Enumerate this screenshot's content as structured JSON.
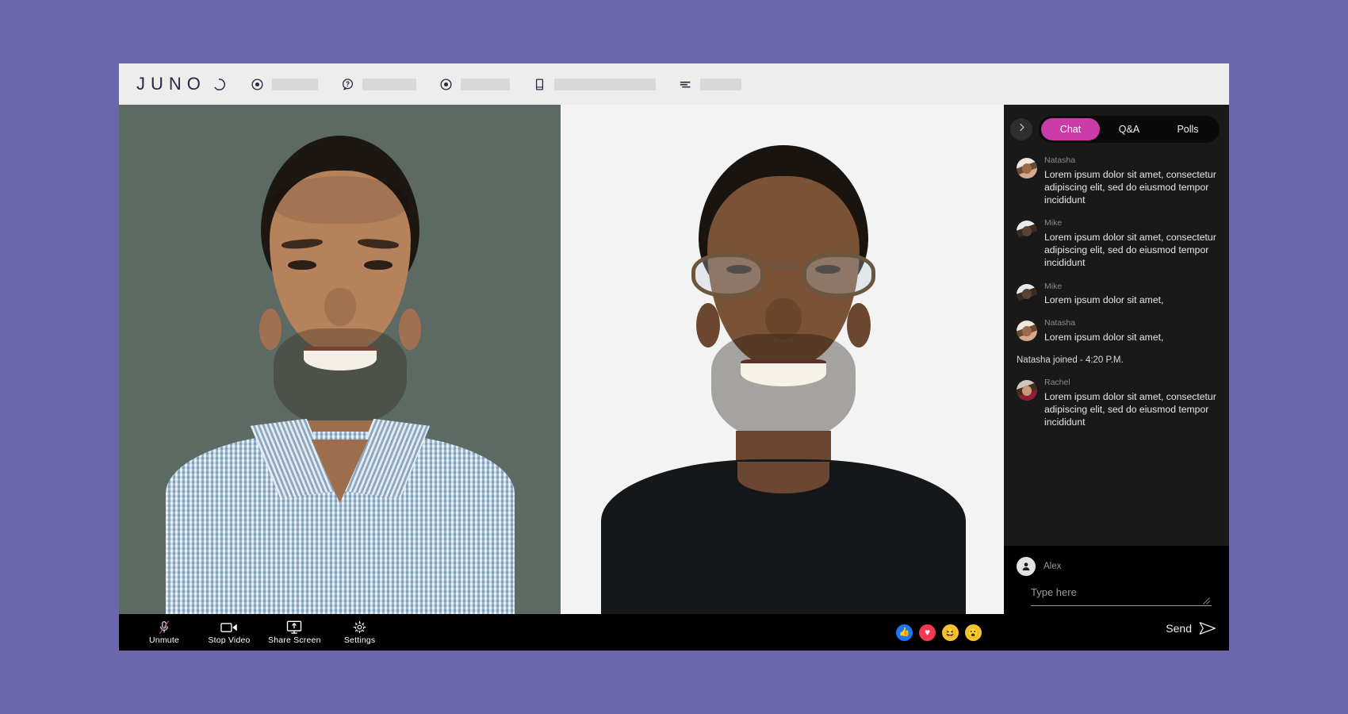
{
  "theme": {
    "page_background": "#6C67AC",
    "header_background": "#EDEDED",
    "chat_background": "#191919",
    "accent_pink": "#CB3BA8",
    "toolbar_background": "#000000"
  },
  "header": {
    "logo_text": "JUNO",
    "nav_items": [
      {
        "icon": "record-dot-icon",
        "placeholder_width": 58
      },
      {
        "icon": "question-bubble-icon",
        "placeholder_width": 68
      },
      {
        "icon": "record-dot-icon",
        "placeholder_width": 62
      },
      {
        "icon": "book-icon",
        "placeholder_width": 128
      },
      {
        "icon": "filter-lines-icon",
        "placeholder_width": 52
      }
    ]
  },
  "stage": {
    "participants": [
      {
        "name": "participant-one",
        "background": "#5C6A63"
      },
      {
        "name": "participant-two",
        "background": "#F2F3F2"
      }
    ]
  },
  "toolbar": {
    "controls": [
      {
        "id": "unmute",
        "label": "Unmute",
        "icon": "microphone-muted-icon"
      },
      {
        "id": "stop-video",
        "label": "Stop Video",
        "icon": "video-camera-icon"
      },
      {
        "id": "share-screen",
        "label": "Share Screen",
        "icon": "share-screen-icon"
      },
      {
        "id": "settings",
        "label": "Settings",
        "icon": "gear-icon"
      }
    ],
    "reactions": [
      {
        "id": "thumbs-up",
        "glyph": "👍",
        "color": "#1877F2"
      },
      {
        "id": "heart",
        "glyph": "♥",
        "color": "#F3384F"
      },
      {
        "id": "laughing",
        "glyph": "😆",
        "color": "#F7C430"
      },
      {
        "id": "surprised",
        "glyph": "😮",
        "color": "#F7C430"
      }
    ]
  },
  "chat": {
    "collapse_icon": "chevron-right-icon",
    "tabs": [
      {
        "id": "chat",
        "label": "Chat",
        "active": true
      },
      {
        "id": "qa",
        "label": "Q&A",
        "active": false
      },
      {
        "id": "polls",
        "label": "Polls",
        "active": false
      }
    ],
    "messages": [
      {
        "author": "Natasha",
        "avatar": "av-natasha",
        "text": "Lorem ipsum dolor sit amet, consectetur adipiscing elit, sed do eiusmod tempor incididunt"
      },
      {
        "author": "Mike",
        "avatar": "av-mike",
        "text": "Lorem ipsum dolor sit amet, consectetur adipiscing elit, sed do eiusmod tempor incididunt"
      },
      {
        "author": "Mike",
        "avatar": "av-mike",
        "text": "Lorem ipsum dolor sit amet,"
      },
      {
        "author": "Natasha",
        "avatar": "av-natasha",
        "text": "Lorem ipsum dolor sit amet,"
      }
    ],
    "system_note": "Natasha joined - 4:20 P.M.",
    "messages_after_note": [
      {
        "author": "Rachel",
        "avatar": "av-rachel",
        "text": "Lorem ipsum dolor sit amet, consectetur adipiscing elit, sed do eiusmod tempor incididunt"
      }
    ],
    "composer": {
      "user_name": "Alex",
      "input_value": "",
      "input_placeholder": "Type here",
      "send_label": "Send",
      "send_icon": "send-paper-plane-icon"
    }
  }
}
